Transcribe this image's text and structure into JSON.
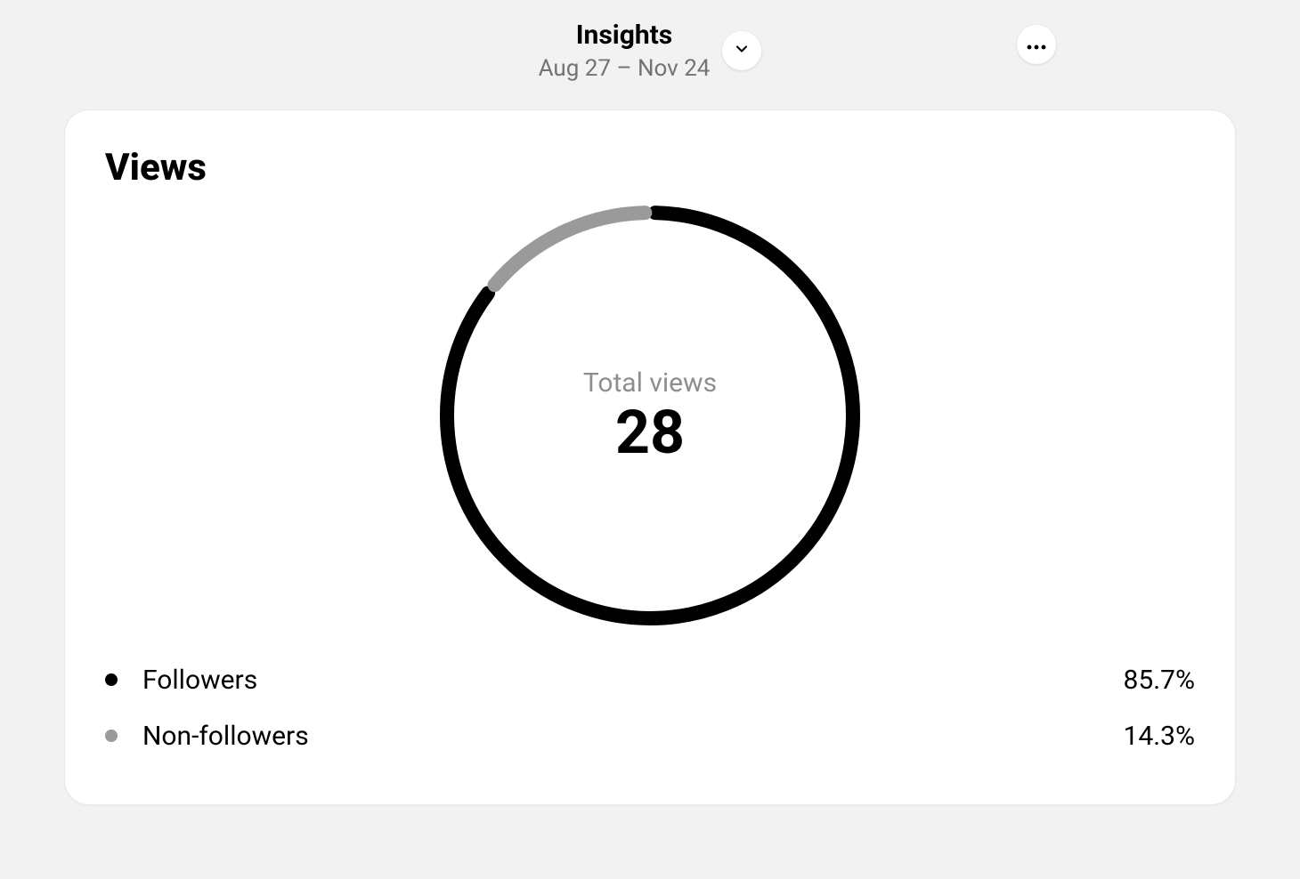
{
  "header": {
    "title": "Insights",
    "date_range": "Aug 27 – Nov 24"
  },
  "card": {
    "title": "Views",
    "center_label": "Total views",
    "center_value": "28"
  },
  "legend": [
    {
      "label": "Followers",
      "value": "85.7%",
      "color": "#000000"
    },
    {
      "label": "Non-followers",
      "value": "14.3%",
      "color": "#9a9a9a"
    }
  ],
  "chart_data": {
    "type": "pie",
    "title": "Views",
    "series": [
      {
        "name": "Followers",
        "value": 85.7,
        "color": "#000000"
      },
      {
        "name": "Non-followers",
        "value": 14.3,
        "color": "#9a9a9a"
      }
    ],
    "total_label": "Total views",
    "total_value": 28
  }
}
